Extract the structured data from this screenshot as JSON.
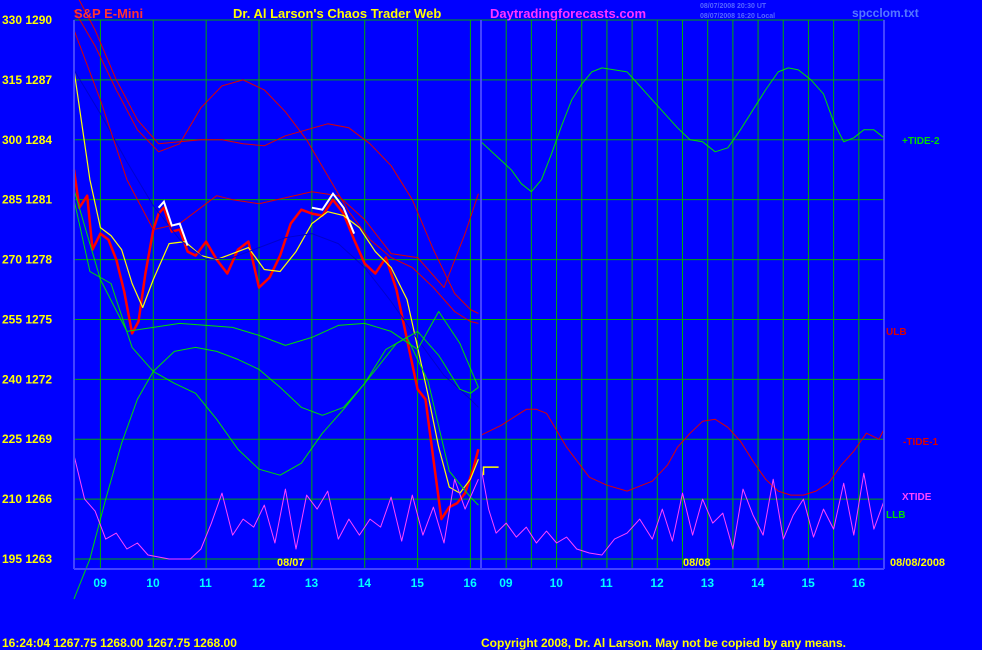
{
  "header": {
    "symbol": "S&P E-Mini",
    "title": "Dr. Al Larson's Chaos Trader Web",
    "website": "Daytradingforecasts.com",
    "timestamp_1": "08/07/2008 20:30 UT",
    "timestamp_2": "08/07/2008 16:20 Local",
    "filename": "spcclom.txt"
  },
  "footer": {
    "quote": "16:24:04  1267.75 1268.00 1267.75 1268.00",
    "copyright": "Copyright 2008, Dr. Al Larson. May not be copied by any means."
  },
  "colors": {
    "background": "#0000ff",
    "grid": "#00aa00",
    "price_red": "#ff0000",
    "price_white": "#ffffff",
    "avg_yellow": "#ffff00",
    "tide_green": "#00dd00",
    "ulb_red": "#dd0000",
    "xtide_magenta": "#ff44ff",
    "blue_line": "#0000cc",
    "title_yellow": "#ffff00",
    "title_red": "#ff3333",
    "title_magenta": "#ff33ff",
    "time_cyan": "#00ffff"
  },
  "chart_data": {
    "type": "line",
    "title": "S&P E-Mini",
    "y_ticks": [
      {
        "pct": "195",
        "price": "1263"
      },
      {
        "pct": "210",
        "price": "1266"
      },
      {
        "pct": "225",
        "price": "1269"
      },
      {
        "pct": "240",
        "price": "1272"
      },
      {
        "pct": "255",
        "price": "1275"
      },
      {
        "pct": "270",
        "price": "1278"
      },
      {
        "pct": "285",
        "price": "1281"
      },
      {
        "pct": "300",
        "price": "1284"
      },
      {
        "pct": "315",
        "price": "1287"
      },
      {
        "pct": "330",
        "price": "1290"
      }
    ],
    "ylim_price": [
      1262.5,
      1290
    ],
    "x_ticks_day1": [
      "09",
      "10",
      "11",
      "12",
      "13",
      "14",
      "15",
      "16"
    ],
    "x_ticks_day2": [
      "09",
      "10",
      "11",
      "12",
      "13",
      "14",
      "15",
      "16"
    ],
    "date_label_1": "08/07",
    "date_label_2": "08/08",
    "date_label_end": "08/08/2008",
    "series_labels": {
      "tide_plus2": "+TIDE-2",
      "ulb": "ULB",
      "tide_minus1": "-TIDE-1",
      "xtide": "XTIDE",
      "llb": "LLB"
    },
    "x_day1_hours": [
      8.5,
      16.2
    ],
    "x_day2_hours": [
      16.2,
      32.2
    ],
    "series": [
      {
        "name": "price_day1",
        "x": [
          8.5,
          8.6,
          8.75,
          8.85,
          9.0,
          9.15,
          9.3,
          9.45,
          9.6,
          9.72,
          9.85,
          10.0,
          10.1,
          10.2,
          10.35,
          10.5,
          10.65,
          10.8,
          11.0,
          11.2,
          11.4,
          11.6,
          11.8,
          12.0,
          12.2,
          12.4,
          12.6,
          12.8,
          13.0,
          13.2,
          13.4,
          13.6,
          13.8,
          14.0,
          14.2,
          14.4,
          14.6,
          14.8,
          15.0,
          15.15,
          15.3,
          15.45,
          15.6,
          15.75,
          15.9,
          16.05,
          16.15
        ],
        "y": [
          1282.5,
          1280.6,
          1281.2,
          1278.5,
          1279.3,
          1279.0,
          1278.0,
          1276.4,
          1274.3,
          1274.9,
          1277.3,
          1279.5,
          1280.3,
          1280.6,
          1279.4,
          1279.5,
          1278.4,
          1278.2,
          1278.9,
          1278.0,
          1277.3,
          1278.5,
          1278.9,
          1276.6,
          1277.1,
          1278.2,
          1279.8,
          1280.5,
          1280.3,
          1280.2,
          1281.0,
          1280.3,
          1279.0,
          1277.8,
          1277.3,
          1278.1,
          1276.5,
          1274.0,
          1271.5,
          1271.0,
          1268.0,
          1265.0,
          1265.6,
          1265.8,
          1266.3,
          1267.5,
          1268.5
        ]
      },
      {
        "name": "avg_day1",
        "x": [
          8.5,
          8.8,
          9.0,
          9.2,
          9.4,
          9.6,
          9.8,
          10.0,
          10.3,
          10.6,
          10.9,
          11.2,
          11.5,
          11.8,
          12.1,
          12.4,
          12.7,
          13.0,
          13.3,
          13.6,
          13.9,
          14.2,
          14.5,
          14.8,
          15.0,
          15.2,
          15.4,
          15.6,
          15.8,
          16.0,
          16.15
        ],
        "y": [
          1287.5,
          1282.0,
          1279.6,
          1279.2,
          1278.5,
          1276.8,
          1275.6,
          1277.0,
          1278.8,
          1278.9,
          1278.2,
          1278.0,
          1278.3,
          1278.6,
          1277.5,
          1277.4,
          1278.4,
          1279.8,
          1280.4,
          1280.2,
          1279.6,
          1278.4,
          1277.6,
          1276.0,
          1273.6,
          1271.2,
          1268.6,
          1266.6,
          1266.3,
          1267.0,
          1268.0
        ]
      },
      {
        "name": "forecast_blue",
        "x": [
          8.5,
          9.0,
          9.5,
          10.0,
          10.5,
          11.0,
          11.5,
          12.0,
          12.5,
          13.0,
          13.5,
          14.0,
          14.5,
          15.0,
          15.5,
          16.0,
          16.15
        ],
        "y": [
          1287.5,
          1285.3,
          1282.9,
          1280.7,
          1279.0,
          1278.0,
          1278.1,
          1278.6,
          1279.1,
          1279.3,
          1278.8,
          1277.6,
          1275.9,
          1274.0,
          1272.2,
          1271.0,
          1270.6
        ]
      },
      {
        "name": "ulb_day1",
        "x": [
          8.5,
          8.9,
          9.3,
          9.7,
          10.1,
          10.5,
          10.9,
          11.3,
          11.7,
          12.1,
          12.5,
          12.9,
          13.3,
          13.7,
          14.1,
          14.5,
          14.9,
          15.3,
          15.7,
          16.0,
          16.15
        ],
        "y": [
          1290.5,
          1288.7,
          1286.5,
          1284.5,
          1283.4,
          1283.8,
          1285.6,
          1286.7,
          1287.0,
          1286.5,
          1285.4,
          1284.0,
          1282.2,
          1280.4,
          1279.0,
          1278.1,
          1277.6,
          1276.6,
          1275.4,
          1274.9,
          1274.8
        ]
      },
      {
        "name": "red_upper_day1",
        "x": [
          8.5,
          8.9,
          9.3,
          9.7,
          10.1,
          10.5,
          10.9,
          11.3,
          11.7,
          12.1,
          12.5,
          12.9,
          13.3,
          13.7,
          14.1,
          14.5,
          14.9,
          15.3,
          15.7,
          16.0,
          16.15
        ],
        "y": [
          1291.5,
          1289.5,
          1287.0,
          1285.0,
          1283.8,
          1283.9,
          1284.0,
          1284.0,
          1283.8,
          1283.7,
          1284.2,
          1284.5,
          1284.8,
          1284.6,
          1283.8,
          1282.7,
          1281.0,
          1278.5,
          1276.3,
          1275.5,
          1275.3
        ]
      },
      {
        "name": "red_fan_day1",
        "x": [
          8.5,
          9.0,
          9.5,
          10.0,
          10.5,
          11.0,
          11.2,
          11.5,
          12.0,
          13.0,
          13.5,
          14.0,
          14.5,
          15.0,
          15.5,
          15.9,
          16.15
        ],
        "y": [
          1289.5,
          1286.0,
          1282.0,
          1279.5,
          1279.8,
          1280.8,
          1281.2,
          1281.0,
          1280.8,
          1281.4,
          1281.2,
          1280.0,
          1278.3,
          1278.1,
          1276.6,
          1279.3,
          1281.3
        ]
      },
      {
        "name": "green_mid_day1",
        "x": [
          8.5,
          9.0,
          9.5,
          10.0,
          10.5,
          11.0,
          11.5,
          12.0,
          12.5,
          13.0,
          13.5,
          14.0,
          14.5,
          15.0,
          15.4,
          15.8,
          16.15
        ],
        "y": [
          1281.5,
          1277.0,
          1274.4,
          1274.6,
          1274.8,
          1274.7,
          1274.6,
          1274.2,
          1273.7,
          1274.1,
          1274.7,
          1274.8,
          1274.4,
          1273.5,
          1275.4,
          1273.8,
          1271.6
        ]
      },
      {
        "name": "green_low_day1",
        "x": [
          8.5,
          8.8,
          9.2,
          9.6,
          10.0,
          10.4,
          10.8,
          11.2,
          11.6,
          12.0,
          12.4,
          12.8,
          13.2,
          13.6,
          14.0,
          14.4,
          14.8,
          15.2,
          15.6,
          16.0,
          16.15
        ],
        "y": [
          1281.0,
          1277.4,
          1276.8,
          1273.6,
          1272.4,
          1271.8,
          1271.3,
          1270.0,
          1268.5,
          1267.5,
          1267.2,
          1267.8,
          1269.3,
          1270.5,
          1271.8,
          1273.5,
          1274.1,
          1271.9,
          1267.4,
          1266.1,
          1265.7
        ]
      },
      {
        "name": "green_rising_day1",
        "x": [
          8.5,
          8.8,
          9.1,
          9.4,
          9.7,
          10.0,
          10.4,
          10.8,
          11.2,
          11.6,
          12.0,
          12.4,
          12.8,
          13.2,
          13.6,
          14.0,
          14.3,
          14.6,
          15.0,
          15.4,
          15.8,
          16.0,
          16.15
        ],
        "y": [
          1261.0,
          1263.0,
          1266.0,
          1268.8,
          1271.0,
          1272.4,
          1273.4,
          1273.6,
          1273.4,
          1273.0,
          1272.5,
          1271.6,
          1270.6,
          1270.2,
          1270.6,
          1271.8,
          1272.8,
          1273.8,
          1274.4,
          1273.2,
          1271.5,
          1271.3,
          1271.6
        ]
      },
      {
        "name": "xtide_day1",
        "x": [
          8.5,
          8.7,
          8.9,
          9.1,
          9.3,
          9.5,
          9.7,
          9.9,
          10.1,
          10.3,
          10.5,
          10.7,
          10.9,
          11.1,
          11.3,
          11.5,
          11.7,
          11.9,
          12.1,
          12.3,
          12.5,
          12.7,
          12.9,
          13.1,
          13.3,
          13.5,
          13.7,
          13.9,
          14.1,
          14.3,
          14.5,
          14.7,
          14.9,
          15.1,
          15.3,
          15.5,
          15.7,
          15.9,
          16.15
        ],
        "y": [
          1268.2,
          1266.0,
          1265.4,
          1264.0,
          1264.3,
          1263.5,
          1263.8,
          1263.2,
          1263.1,
          1263.0,
          1263.0,
          1263.0,
          1263.5,
          1264.8,
          1266.3,
          1264.2,
          1265.0,
          1264.6,
          1265.7,
          1263.8,
          1266.5,
          1263.5,
          1266.2,
          1265.5,
          1266.4,
          1264.0,
          1265.0,
          1264.2,
          1265.0,
          1264.6,
          1266.1,
          1263.9,
          1266.2,
          1264.2,
          1265.6,
          1263.8,
          1267.0,
          1265.5,
          1267.0
        ]
      },
      {
        "name": "plus_tide_2",
        "x": [
          16.2,
          16.8,
          17.4,
          17.8,
          18.2,
          18.6,
          19.0,
          19.4,
          19.8,
          20.2,
          20.6,
          21.0,
          22.0,
          23.0,
          24.0,
          24.5,
          25.0,
          25.5,
          26.0,
          26.5,
          27.0,
          27.5,
          28.0,
          28.4,
          28.8,
          29.3,
          29.8,
          30.2,
          30.6,
          31.0,
          31.4,
          31.8,
          32.2
        ],
        "y": [
          1283.9,
          1283.2,
          1282.5,
          1281.8,
          1281.4,
          1282.0,
          1283.3,
          1284.7,
          1286.0,
          1286.8,
          1287.4,
          1287.6,
          1287.4,
          1286.0,
          1284.6,
          1284.0,
          1283.9,
          1283.4,
          1283.6,
          1284.5,
          1285.5,
          1286.5,
          1287.4,
          1287.6,
          1287.5,
          1287.0,
          1286.3,
          1284.9,
          1283.9,
          1284.1,
          1284.5,
          1284.5,
          1284.1
        ]
      },
      {
        "name": "minus_tide_1",
        "x": [
          16.2,
          17.0,
          18.0,
          18.4,
          18.8,
          19.6,
          20.5,
          21.2,
          22.0,
          23.0,
          23.6,
          24.0,
          24.5,
          25.0,
          25.5,
          26.0,
          26.5,
          27.0,
          27.5,
          28.0,
          28.5,
          29.0,
          29.5,
          30.0,
          30.5,
          31.0,
          31.5,
          32.0,
          32.2
        ],
        "y": [
          1269.2,
          1269.7,
          1270.5,
          1270.5,
          1270.3,
          1268.6,
          1267.1,
          1266.7,
          1266.4,
          1266.9,
          1267.7,
          1268.6,
          1269.3,
          1269.9,
          1270.0,
          1269.6,
          1268.9,
          1267.9,
          1267.0,
          1266.4,
          1266.2,
          1266.2,
          1266.4,
          1266.8,
          1267.7,
          1268.4,
          1269.3,
          1269.0,
          1269.5
        ]
      },
      {
        "name": "xtide_day2",
        "x": [
          16.2,
          16.5,
          16.8,
          17.2,
          17.6,
          18.0,
          18.4,
          18.8,
          19.2,
          19.6,
          20.0,
          20.5,
          21.0,
          21.5,
          22.0,
          22.5,
          23.0,
          23.4,
          23.8,
          24.2,
          24.6,
          25.0,
          25.4,
          25.8,
          26.2,
          26.6,
          27.0,
          27.4,
          27.8,
          28.2,
          28.6,
          29.0,
          29.4,
          29.8,
          30.2,
          30.6,
          31.0,
          31.4,
          31.8,
          32.2
        ],
        "y": [
          1267.6,
          1265.5,
          1264.3,
          1264.8,
          1264.1,
          1264.6,
          1263.8,
          1264.4,
          1263.8,
          1264.1,
          1263.5,
          1263.3,
          1263.2,
          1264.0,
          1264.3,
          1265.0,
          1264.0,
          1265.5,
          1263.9,
          1266.3,
          1264.2,
          1266.0,
          1264.8,
          1265.3,
          1263.5,
          1266.5,
          1265.2,
          1264.2,
          1267.0,
          1264.0,
          1265.2,
          1266.0,
          1264.1,
          1265.5,
          1264.5,
          1266.8,
          1264.2,
          1267.3,
          1264.5,
          1265.9
        ]
      }
    ],
    "grid": true
  }
}
